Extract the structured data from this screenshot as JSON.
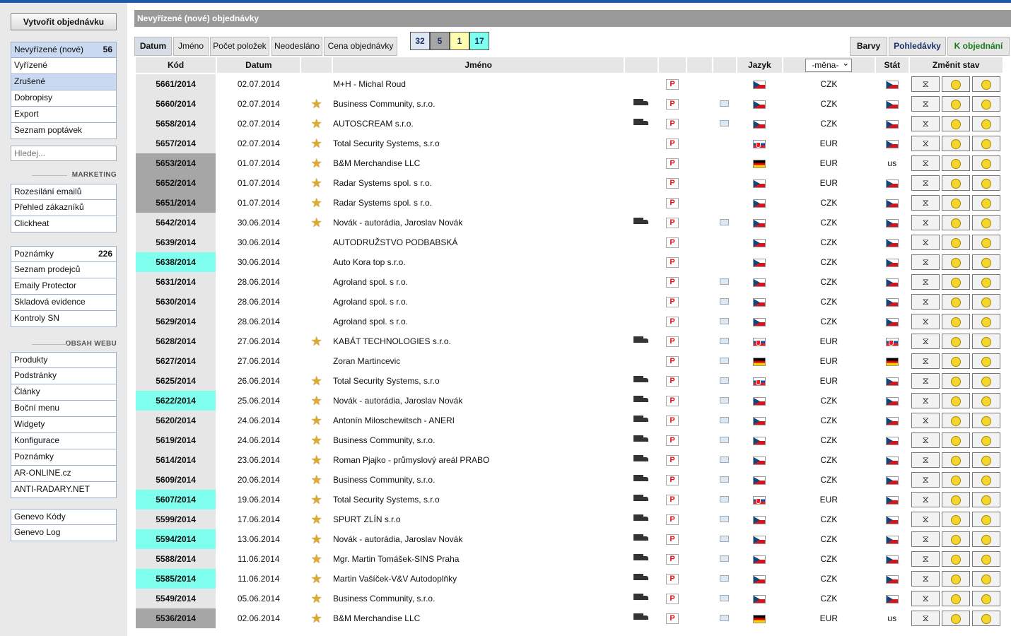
{
  "create_button": "Vytvořit objednávku",
  "menu1": [
    {
      "label": "Nevyřízené (nové)",
      "count": "56",
      "selected": true
    },
    {
      "label": "Vyřízené",
      "count": "",
      "selected": false
    },
    {
      "label": "Zrušené",
      "count": "",
      "selected": true
    },
    {
      "label": "Dobropisy",
      "count": "",
      "selected": false
    },
    {
      "label": "Export",
      "count": "",
      "selected": false
    },
    {
      "label": "Seznam poptávek",
      "count": "",
      "selected": false
    }
  ],
  "search_placeholder": "Hledej...",
  "section_marketing": "MARKETING",
  "menu_marketing": [
    "Rozesílání emailů",
    "Přehled zákazníků",
    "Clickheat"
  ],
  "menu3": [
    {
      "label": "Poznámky",
      "count": "226"
    },
    {
      "label": "Seznam prodejců",
      "count": ""
    },
    {
      "label": "Emaily Protector",
      "count": ""
    },
    {
      "label": "Skladová evidence",
      "count": ""
    },
    {
      "label": "Kontroly SN",
      "count": ""
    }
  ],
  "section_obsah": "OBSAH WEBU",
  "menu_obsah": [
    "Produkty",
    "Podstránky",
    "Články",
    "Boční menu",
    "Widgety",
    "Konfigurace",
    "Poznámky",
    "AR-ONLINE.cz",
    "ANTI-RADARY.NET"
  ],
  "menu_genevo": [
    "Genevo Kódy",
    "Genevo Log"
  ],
  "title": "Nevyřízené (nové) objednávky",
  "tabs": [
    "Datum",
    "Jméno",
    "Počet položek",
    "Neodesláno",
    "Cena objednávky"
  ],
  "tabs_right": [
    "Barvy",
    "Pohledávky",
    "K objednání"
  ],
  "color_counts": [
    {
      "value": "32",
      "color": "#dfe7f3"
    },
    {
      "value": "5",
      "color": "#a6a6a6"
    },
    {
      "value": "1",
      "color": "#fdfdb0"
    },
    {
      "value": "17",
      "color": "#7fffee"
    }
  ],
  "headers": {
    "kod": "Kód",
    "datum": "Datum",
    "jmeno": "Jméno",
    "jazyk": "Jazyk",
    "mena": "-měna-",
    "stat": "Stát",
    "zmenit": "Změnit stav"
  },
  "orders": [
    {
      "kod": "5661/2014",
      "datum": "02.07.2014",
      "star": false,
      "jmeno": "M+H - Michal Roud",
      "truck": false,
      "mail": false,
      "lang": "cz",
      "mena": "CZK",
      "stat": "cz",
      "color": ""
    },
    {
      "kod": "5660/2014",
      "datum": "02.07.2014",
      "star": true,
      "jmeno": "Business Community, s.r.o.",
      "truck": true,
      "mail": true,
      "lang": "cz",
      "mena": "CZK",
      "stat": "cz",
      "color": ""
    },
    {
      "kod": "5658/2014",
      "datum": "02.07.2014",
      "star": true,
      "jmeno": "AUTOSCREAM s.r.o.",
      "truck": true,
      "mail": true,
      "lang": "cz",
      "mena": "CZK",
      "stat": "cz",
      "color": ""
    },
    {
      "kod": "5657/2014",
      "datum": "02.07.2014",
      "star": true,
      "jmeno": "Total Security Systems, s.r.o",
      "truck": false,
      "mail": false,
      "lang": "sk",
      "mena": "EUR",
      "stat": "cz",
      "color": ""
    },
    {
      "kod": "5653/2014",
      "datum": "01.07.2014",
      "star": true,
      "jmeno": "B&M Merchandise LLC",
      "truck": false,
      "mail": false,
      "lang": "de",
      "mena": "EUR",
      "stat": "us",
      "color": "gray"
    },
    {
      "kod": "5652/2014",
      "datum": "01.07.2014",
      "star": true,
      "jmeno": "Radar Systems spol. s r.o.",
      "truck": false,
      "mail": false,
      "lang": "cz",
      "mena": "EUR",
      "stat": "cz",
      "color": "gray"
    },
    {
      "kod": "5651/2014",
      "datum": "01.07.2014",
      "star": true,
      "jmeno": "Radar Systems spol. s r.o.",
      "truck": false,
      "mail": false,
      "lang": "cz",
      "mena": "CZK",
      "stat": "cz",
      "color": "gray"
    },
    {
      "kod": "5642/2014",
      "datum": "30.06.2014",
      "star": true,
      "jmeno": "Novák - autorádia, Jaroslav Novák",
      "truck": true,
      "mail": true,
      "lang": "cz",
      "mena": "CZK",
      "stat": "cz",
      "color": ""
    },
    {
      "kod": "5639/2014",
      "datum": "30.06.2014",
      "star": false,
      "jmeno": "AUTODRUŽSTVO PODBABSKÁ",
      "truck": false,
      "mail": false,
      "lang": "cz",
      "mena": "CZK",
      "stat": "cz",
      "color": ""
    },
    {
      "kod": "5638/2014",
      "datum": "30.06.2014",
      "star": false,
      "jmeno": "Auto Kora top s.r.o.",
      "truck": false,
      "mail": false,
      "lang": "cz",
      "mena": "CZK",
      "stat": "cz",
      "color": "cyan"
    },
    {
      "kod": "5631/2014",
      "datum": "28.06.2014",
      "star": false,
      "jmeno": "Agroland spol. s r.o.",
      "truck": false,
      "mail": true,
      "lang": "cz",
      "mena": "CZK",
      "stat": "cz",
      "color": ""
    },
    {
      "kod": "5630/2014",
      "datum": "28.06.2014",
      "star": false,
      "jmeno": "Agroland spol. s r.o.",
      "truck": false,
      "mail": true,
      "lang": "cz",
      "mena": "CZK",
      "stat": "cz",
      "color": ""
    },
    {
      "kod": "5629/2014",
      "datum": "28.06.2014",
      "star": false,
      "jmeno": "Agroland spol. s r.o.",
      "truck": false,
      "mail": true,
      "lang": "cz",
      "mena": "CZK",
      "stat": "cz",
      "color": ""
    },
    {
      "kod": "5628/2014",
      "datum": "27.06.2014",
      "star": true,
      "jmeno": "KABÁT TECHNOLOGIES s.r.o.",
      "truck": true,
      "mail": true,
      "lang": "sk",
      "mena": "EUR",
      "stat": "sk",
      "color": ""
    },
    {
      "kod": "5627/2014",
      "datum": "27.06.2014",
      "star": false,
      "jmeno": "Zoran Martincevic",
      "truck": false,
      "mail": true,
      "lang": "de",
      "mena": "EUR",
      "stat": "de",
      "color": ""
    },
    {
      "kod": "5625/2014",
      "datum": "26.06.2014",
      "star": true,
      "jmeno": "Total Security Systems, s.r.o",
      "truck": true,
      "mail": true,
      "lang": "sk",
      "mena": "EUR",
      "stat": "cz",
      "color": ""
    },
    {
      "kod": "5622/2014",
      "datum": "25.06.2014",
      "star": true,
      "jmeno": "Novák - autorádia, Jaroslav Novák",
      "truck": true,
      "mail": true,
      "lang": "cz",
      "mena": "CZK",
      "stat": "cz",
      "color": "cyan"
    },
    {
      "kod": "5620/2014",
      "datum": "24.06.2014",
      "star": true,
      "jmeno": "Antonín Miloschewitsch - ANERI",
      "truck": true,
      "mail": true,
      "lang": "cz",
      "mena": "CZK",
      "stat": "cz",
      "color": ""
    },
    {
      "kod": "5619/2014",
      "datum": "24.06.2014",
      "star": true,
      "jmeno": "Business Community, s.r.o.",
      "truck": true,
      "mail": true,
      "lang": "cz",
      "mena": "CZK",
      "stat": "cz",
      "color": ""
    },
    {
      "kod": "5614/2014",
      "datum": "23.06.2014",
      "star": true,
      "jmeno": "Roman Pjajko - průmyslový areál PRABO",
      "truck": true,
      "mail": true,
      "lang": "cz",
      "mena": "CZK",
      "stat": "cz",
      "color": ""
    },
    {
      "kod": "5609/2014",
      "datum": "20.06.2014",
      "star": true,
      "jmeno": "Business Community, s.r.o.",
      "truck": true,
      "mail": true,
      "lang": "cz",
      "mena": "CZK",
      "stat": "cz",
      "color": ""
    },
    {
      "kod": "5607/2014",
      "datum": "19.06.2014",
      "star": true,
      "jmeno": "Total Security Systems, s.r.o",
      "truck": true,
      "mail": true,
      "lang": "sk",
      "mena": "EUR",
      "stat": "cz",
      "color": "cyan"
    },
    {
      "kod": "5599/2014",
      "datum": "17.06.2014",
      "star": true,
      "jmeno": "SPURT ZLÍN s.r.o",
      "truck": true,
      "mail": true,
      "lang": "cz",
      "mena": "CZK",
      "stat": "cz",
      "color": ""
    },
    {
      "kod": "5594/2014",
      "datum": "13.06.2014",
      "star": true,
      "jmeno": "Novák - autorádia, Jaroslav Novák",
      "truck": true,
      "mail": true,
      "lang": "cz",
      "mena": "CZK",
      "stat": "cz",
      "color": "cyan"
    },
    {
      "kod": "5588/2014",
      "datum": "11.06.2014",
      "star": true,
      "jmeno": "Mgr. Martin Tomášek-SINS Praha",
      "truck": true,
      "mail": true,
      "lang": "cz",
      "mena": "CZK",
      "stat": "cz",
      "color": ""
    },
    {
      "kod": "5585/2014",
      "datum": "11.06.2014",
      "star": true,
      "jmeno": "Martin Vašíček-V&V Autodoplňky",
      "truck": true,
      "mail": true,
      "lang": "cz",
      "mena": "CZK",
      "stat": "cz",
      "color": "cyan"
    },
    {
      "kod": "5549/2014",
      "datum": "05.06.2014",
      "star": true,
      "jmeno": "Business Community, s.r.o.",
      "truck": true,
      "mail": true,
      "lang": "cz",
      "mena": "CZK",
      "stat": "cz",
      "color": ""
    },
    {
      "kod": "5536/2014",
      "datum": "02.06.2014",
      "star": true,
      "jmeno": "B&M Merchandise LLC",
      "truck": true,
      "mail": true,
      "lang": "de",
      "mena": "EUR",
      "stat": "us",
      "color": "gray"
    }
  ],
  "icons": {
    "truck": "truck-icon",
    "p": "P",
    "mail": "mail-icon",
    "star": "star-icon",
    "hourglass": "hourglass-icon",
    "happy": "smiley-happy-icon",
    "sad": "smiley-sad-icon"
  }
}
